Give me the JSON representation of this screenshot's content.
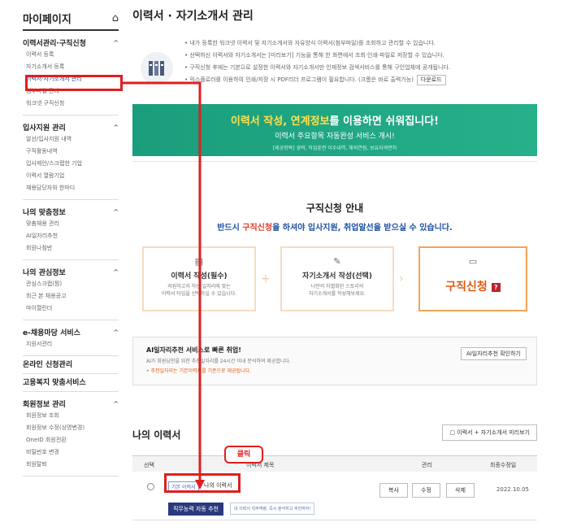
{
  "sidebar": {
    "title": "마이페이지",
    "groups": [
      {
        "title": "이력서관리·구직신청",
        "items": [
          "이력서 등록",
          "자기소개서 등록",
          "이력서·자기소개서 관리",
          "첨부파일 관리",
          "워크넷 구직신청"
        ]
      },
      {
        "title": "입사지원 관리",
        "items": [
          "알선/입사지원 내역",
          "구직활동내역",
          "입사제안/스크랩한 기업",
          "이력서 열람기업",
          "채용담당자와 한마디"
        ]
      },
      {
        "title": "나의 맞춤정보",
        "items": [
          "맞춤채용 관리",
          "AI일자리추천",
          "회원나침반"
        ]
      },
      {
        "title": "나의 관심정보",
        "items": [
          "관심스크랩(찜)",
          "최근 본 채용공고",
          "마이캘린더"
        ]
      },
      {
        "title": "e-채용마당 서비스",
        "items": [
          "지원서관리"
        ]
      }
    ],
    "singles": [
      "온라인 신청관리",
      "고용복지 맞춤서비스"
    ],
    "member": {
      "title": "회원정보 관리",
      "items": [
        "회원정보 조회",
        "회원정보 수정(상명변경)",
        "OneID 회원전환",
        "비밀번호 변경",
        "회원탈퇴"
      ]
    }
  },
  "main": {
    "title": "이력서 · 자기소개서 관리",
    "info": [
      "내가 등록한 워크넷 이력서 및 자기소개서와 자유양식 이력서(첨부파일)를 조회하고 관리할 수 있습니다.",
      "선택하신 이력서와 자기소개서는 [미리보기] 기능을 통해 한 화면에서 조회·인쇄·파일로 저장할 수 있습니다.",
      "구직신청 후에는 기본으로 설정한 이력서와 자기소개서만 인재정보 검색서비스를 통해 구인업체에 공개됩니다.",
      "익스플로러를 이용하여 인쇄/저장 시 PDF리더 프로그램이 필요합니다. (크롬은 바로 출력가능)"
    ],
    "download": "다운로드",
    "banner": {
      "hl": "이력서 작성, 연계정보",
      "rest": "를 이용하면 쉬워집니다!",
      "line2": "이력서 주요항목 자동완성 서비스 개시!",
      "line3": "[제공항목] 경력, 직업훈련 이수내역, 해외연점, 보유자격면허"
    },
    "apply": {
      "title": "구직신청 안내",
      "sub_a": "반드시 ",
      "sub_r": "구직신청",
      "sub_b": "을 하셔야 입사지원, 취업알선을 받으실 수 있습니다.",
      "step1": {
        "title": "이력서 작성(필수)",
        "desc1": "지원하고자 하는 일자리에 맞는",
        "desc2": "이력서 타입을 선택하실 수 있습니다."
      },
      "step2": {
        "title": "자기소개서 작성(선택)",
        "desc1": "나만의 차별화된 스토리의",
        "desc2": "자기소개서를 작성해보세요."
      },
      "step3": {
        "title": "구직신청",
        "badge": "?"
      }
    },
    "ai": {
      "title": "AI일자리추천 서비스로 빠른 취업!",
      "desc": "AI가 회원님만을 위한 추천일자리를 24시간 이내 분석하여 제공합니다.",
      "note": "• 추천일자리는 기본이력서를 기준으로 제공됩니다.",
      "button": "AI일자리추천 확인하기"
    },
    "my": {
      "title": "나의 이력서",
      "preview": "이력서 + 자기소개서 미리보기",
      "headers": {
        "select": "선택",
        "subject": "이력서 제목",
        "manage": "관리",
        "modified": "최종수정일"
      },
      "row": {
        "tag": "기본 이력서",
        "name": "나의 이력서",
        "copy": "복사",
        "edit": "수정",
        "delete": "삭제",
        "date": "2022.10.05",
        "job_btn": "직무능력 자동 추천",
        "job_tip": "내 이력서 직무역량, 즉시 분석하고 추천하자!"
      }
    }
  },
  "annotation": {
    "click": "클릭"
  },
  "colors": {
    "annotation": "#e01e1e",
    "banner": "#1a9d7c",
    "accent": "#1e4fa1",
    "orange": "#e05a12"
  }
}
